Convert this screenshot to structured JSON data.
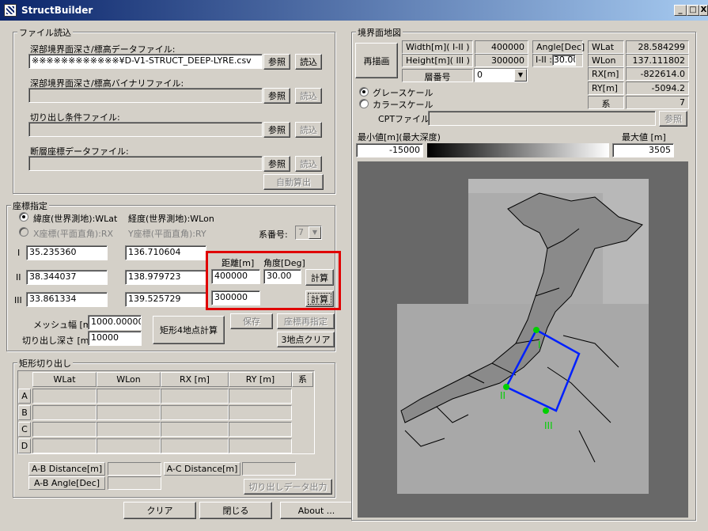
{
  "window": {
    "title": "StructBuilder",
    "btn_min": "_",
    "btn_max": "□",
    "btn_close": "X"
  },
  "file_group": {
    "legend": "ファイル読込",
    "deep_label": "深部境界面深さ/標高データファイル:",
    "deep_value": "※※※※※※※※※※※※¥D-V1-STRUCT_DEEP-LYRE.csv",
    "bin_label": "深部境界面深さ/標高バイナリファイル:",
    "cut_label": "切り出し条件ファイル:",
    "fault_label": "断層座標データファイル:",
    "browse": "参照",
    "load": "読込",
    "auto": "自動算出"
  },
  "coord_group": {
    "legend": "座標指定",
    "radio_latlon": "緯度(世界測地):WLat",
    "radio_lon": "経度(世界測地):WLon",
    "radio_xy": "X座標(平面直角):RX",
    "radio_y": "Y座標(平面直角):RY",
    "kei_label": "系番号:",
    "kei_value": "7",
    "p1": "I",
    "p2": "II",
    "p3": "III",
    "p1_lat": "35.235360",
    "p1_lon": "136.710604",
    "p2_lat": "38.344037",
    "p2_lon": "138.979723",
    "p3_lat": "33.861334",
    "p3_lon": "139.525729",
    "dist_label": "距離[m]",
    "angle_label": "角度[Deg]",
    "dist1": "400000",
    "angle1": "30.00",
    "dist2": "300000",
    "calc": "計算",
    "mesh_label": "メッシュ幅 [m]",
    "mesh_value": "1000.000000",
    "depth_label": "切り出し深さ [m]",
    "depth_value": "10000",
    "rect_btn": "矩形4地点計算",
    "save": "保存",
    "respec": "座標再指定",
    "clear3": "3地点クリア"
  },
  "rect_group": {
    "legend": "矩形切り出し",
    "cols": [
      "WLat",
      "WLon",
      "RX [m]",
      "RY [m]",
      "系"
    ],
    "rows": [
      "A",
      "B",
      "C",
      "D"
    ],
    "ab_dist": "A-B Distance[m]",
    "ac_dist": "A-C Distance[m]",
    "ab_angle": "A-B Angle[Dec]",
    "export": "切り出しデータ出力"
  },
  "bottom": {
    "clear": "クリア",
    "close": "閉じる",
    "about": "About ..."
  },
  "map_group": {
    "legend": "境界面地図",
    "redraw": "再描画",
    "width_label": "Width[m]( I-II )",
    "width_value": "400000",
    "height_label": "Height[m]( III )",
    "height_value": "300000",
    "angle_label": "Angle[Dec]",
    "angle_sub": "I-II :",
    "angle_value": "30.00",
    "layer_label": "層番号",
    "layer_value": "0",
    "wlat_label": "WLat",
    "wlat_value": "28.584299",
    "wlon_label": "WLon",
    "wlon_value": "137.111802",
    "rx_label": "RX[m]",
    "rx_value": "-822614.0",
    "ry_label": "RY[m]",
    "ry_value": "-5094.2",
    "kei_label": "系",
    "kei_value": "7",
    "gray": "グレースケール",
    "color": "カラースケール",
    "cpt_label": "CPTファイル:",
    "cpt_browse": "参照",
    "min_label": "最小値[m](最大深度)",
    "min_value": "-15000",
    "max_label": "最大値 [m]",
    "max_value": "3505",
    "marker_1": "I",
    "marker_2": "II",
    "marker_3": "III"
  }
}
